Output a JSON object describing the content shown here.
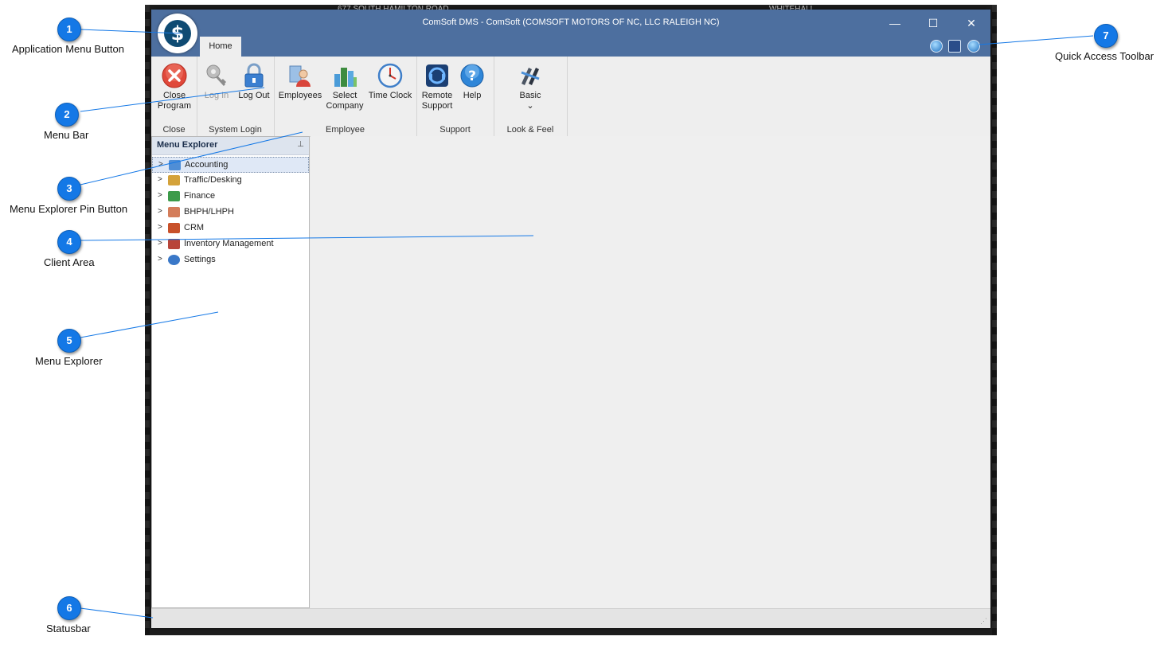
{
  "backdrop": {
    "address_text": "677 SOUTH HAMILTON ROAD",
    "city_text": "WHITEHALL"
  },
  "window": {
    "title": "ComSoft DMS - ComSoft (COMSOFT MOTORS OF NC, LLC RALEIGH NC)",
    "minimize_glyph": "—",
    "maximize_glyph": "☐",
    "close_glyph": "✕",
    "app_button_symbol": "$",
    "tab": "Home"
  },
  "ribbon": {
    "groups": [
      {
        "label": "Close",
        "buttons": [
          {
            "label": "Close Program",
            "line1": "Close",
            "line2": "Program",
            "icon": "close-circle-icon"
          }
        ]
      },
      {
        "label": "System Login",
        "buttons": [
          {
            "label": "Log In",
            "icon": "key-icon",
            "disabled": true
          },
          {
            "label": "Log Out",
            "icon": "padlock-icon"
          }
        ]
      },
      {
        "label": "Employee",
        "buttons": [
          {
            "label": "Employees",
            "icon": "employees-icon"
          },
          {
            "label": "Select Company",
            "line1": "Select",
            "line2": "Company",
            "icon": "company-icon"
          },
          {
            "label": "Time Clock",
            "icon": "clock-icon"
          }
        ]
      },
      {
        "label": "Support",
        "buttons": [
          {
            "label": "Remote Support",
            "line1": "Remote",
            "line2": "Support",
            "icon": "remote-support-icon"
          },
          {
            "label": "Help",
            "icon": "help-icon"
          }
        ]
      },
      {
        "label": "Look & Feel",
        "buttons": [
          {
            "label": "Basic",
            "icon": "theme-icon",
            "dropdown": "⌄"
          }
        ]
      }
    ]
  },
  "explorer": {
    "title": "Menu Explorer",
    "pin_glyph": "⊥",
    "items": [
      {
        "label": "Accounting",
        "icon": "calculator-icon",
        "color": "#4f8ed6",
        "selected": true
      },
      {
        "label": "Traffic/Desking",
        "icon": "signpost-icon",
        "color": "#d4a23a"
      },
      {
        "label": "Finance",
        "icon": "money-icon",
        "color": "#3c9b4a"
      },
      {
        "label": "BHPH/LHPH",
        "icon": "handshake-icon",
        "color": "#d47d5a"
      },
      {
        "label": "CRM",
        "icon": "crm-icon",
        "color": "#c8512a"
      },
      {
        "label": "Inventory Management",
        "icon": "car-icon",
        "color": "#b8453a"
      },
      {
        "label": "Settings",
        "icon": "gear-icon",
        "color": "#3a78c8"
      }
    ]
  },
  "callouts": [
    {
      "number": "1",
      "label": "Application Menu Button"
    },
    {
      "number": "2",
      "label": "Menu Bar"
    },
    {
      "number": "3",
      "label": "Menu Explorer Pin Button"
    },
    {
      "number": "4",
      "label": "Client Area"
    },
    {
      "number": "5",
      "label": "Menu Explorer"
    },
    {
      "number": "6",
      "label": "Statusbar"
    },
    {
      "number": "7",
      "label": "Quick Access Toolbar"
    }
  ],
  "colors": {
    "titlebar": "#4d6f9f",
    "callout": "#1478e6",
    "client": "#efefef"
  }
}
